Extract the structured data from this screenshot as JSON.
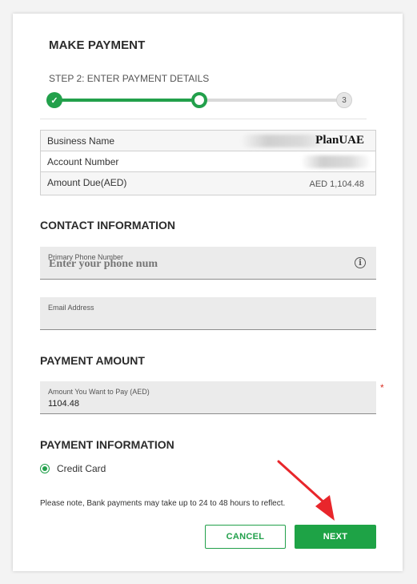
{
  "header": {
    "title": "MAKE PAYMENT",
    "step_label": "STEP 2: ENTER PAYMENT DETAILS",
    "steps": [
      {
        "status": "completed",
        "icon": "check-icon",
        "text": "✓"
      },
      {
        "status": "current",
        "text": ""
      },
      {
        "status": "pending",
        "text": "3"
      }
    ],
    "current_step": 2,
    "total_steps": 3
  },
  "details": {
    "rows": [
      {
        "label": "Business Name",
        "value": "PlanUAE"
      },
      {
        "label": "Account Number",
        "value": ""
      },
      {
        "label": "Amount Due(AED)",
        "value": "AED 1,104.48"
      }
    ]
  },
  "contact": {
    "section_title": "CONTACT INFORMATION",
    "phone_label": "Primary Phone Number",
    "phone_placeholder": "Enter your phone num",
    "info_icon": "i",
    "email_label": "Email Address",
    "email_value": ""
  },
  "payment_amount": {
    "section_title": "PAYMENT AMOUNT",
    "label": "Amount You Want to Pay (AED)",
    "value": "1104.48",
    "required_marker": "*"
  },
  "payment_info": {
    "section_title": "PAYMENT INFORMATION",
    "method": "Credit Card",
    "selected": true,
    "note": "Please note, Bank payments may take up to 24 to 48 hours to reflect."
  },
  "actions": {
    "cancel_label": "CANCEL",
    "next_label": "NEXT"
  },
  "colors": {
    "accent": "#22a04b",
    "annotation_arrow": "#e8262b",
    "required": "#d93025"
  }
}
